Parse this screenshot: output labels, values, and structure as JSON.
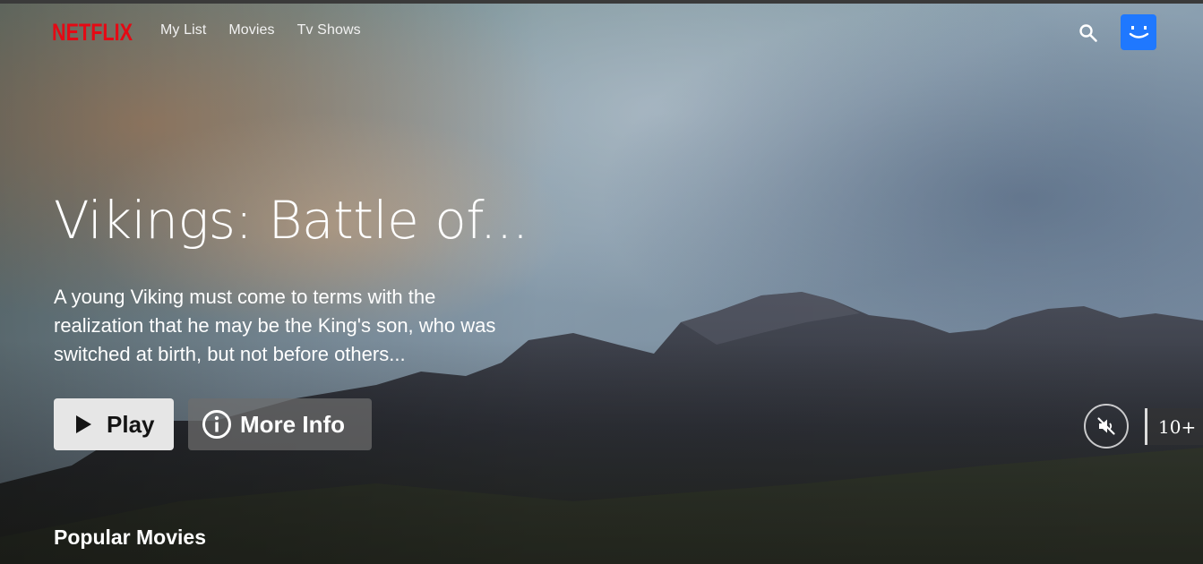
{
  "nav": {
    "logo": "NETFLIX",
    "links": [
      "My List",
      "Movies",
      "Tv Shows"
    ]
  },
  "icons": {
    "search": "search-icon",
    "avatar": "smiley-avatar-icon",
    "play": "play-icon",
    "info": "info-circle-icon",
    "mute": "volume-off-icon"
  },
  "hero": {
    "title": "Vikings: Battle of...",
    "description": "A young Viking must come to terms with the realization that he may be the King's son, who was switched at birth, but not before others...",
    "play_label": "Play",
    "more_info_label": "More Info",
    "maturity_rating": "10+"
  },
  "rows": {
    "popular_title": "Popular Movies"
  },
  "colors": {
    "brand": "#e50914",
    "avatar": "#1f78ff",
    "background": "#141414"
  }
}
